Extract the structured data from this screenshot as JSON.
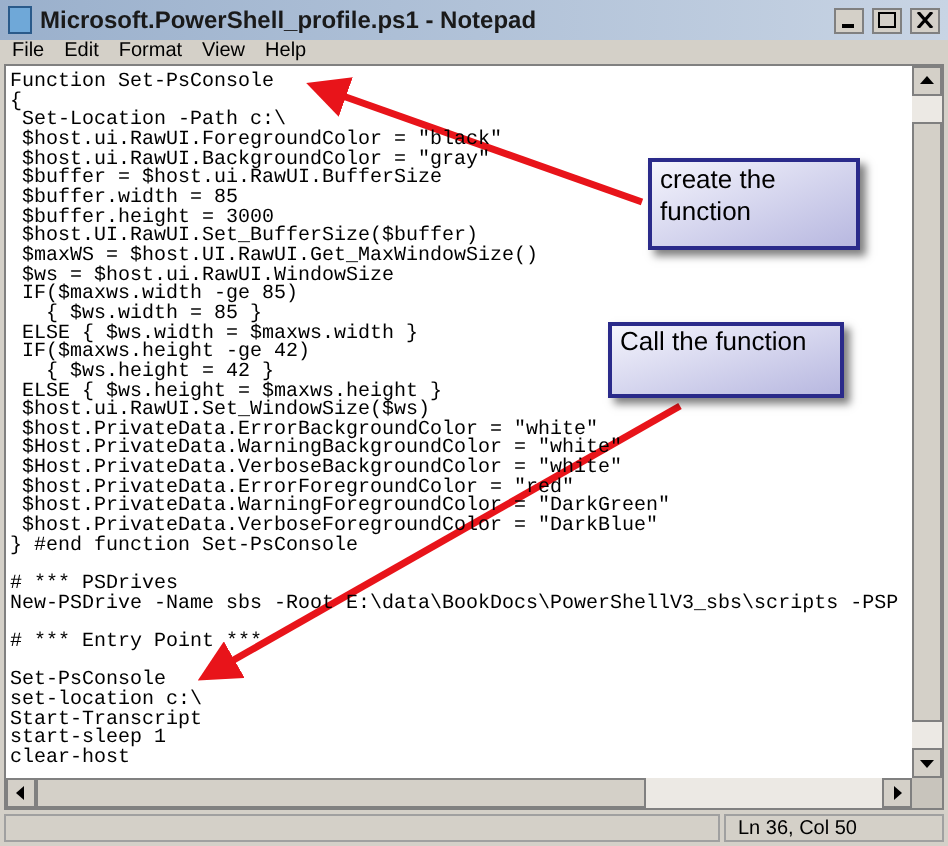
{
  "window": {
    "title": "Microsoft.PowerShell_profile.ps1 - Notepad"
  },
  "menu": [
    "File",
    "Edit",
    "Format",
    "View",
    "Help"
  ],
  "blocks": [
    [
      "Function Set-PsConsole",
      "{",
      " Set-Location -Path c:\\",
      " $host.ui.RawUI.ForegroundColor = \"black\"",
      " $host.ui.RawUI.BackgroundColor = \"gray\"",
      " $buffer = $host.ui.RawUI.BufferSize",
      " $buffer.width = 85",
      " $buffer.height = 3000",
      " $host.UI.RawUI.Set_BufferSize($buffer)",
      " $maxWS = $host.UI.RawUI.Get_MaxWindowSize()",
      " $ws = $host.ui.RawUI.WindowSize",
      " IF($maxws.width -ge 85)",
      "   { $ws.width = 85 }",
      " ELSE { $ws.width = $maxws.width }",
      " IF($maxws.height -ge 42)",
      "   { $ws.height = 42 }",
      " ELSE { $ws.height = $maxws.height }",
      " $host.ui.RawUI.Set_WindowSize($ws)",
      " $host.PrivateData.ErrorBackgroundColor = \"white\"",
      " $Host.PrivateData.WarningBackgroundColor = \"white\"",
      " $Host.PrivateData.VerboseBackgroundColor = \"white\"",
      " $host.PrivateData.ErrorForegroundColor = \"red\"",
      " $host.PrivateData.WarningForegroundColor = \"DarkGreen\"",
      " $host.PrivateData.VerboseForegroundColor = \"DarkBlue\"",
      "} #end function Set-PsConsole"
    ],
    [
      "# *** PSDrives",
      "New-PSDrive -Name sbs -Root E:\\data\\BookDocs\\PowerShellV3_sbs\\scripts -PSP"
    ],
    [
      "# *** Entry Point ***"
    ],
    [
      "Set-PsConsole",
      "set-location c:\\",
      "Start-Transcript",
      "start-sleep 1",
      "clear-host"
    ]
  ],
  "callouts": [
    "create the function",
    "Call the function"
  ],
  "status_bar": {
    "position": "Ln 36, Col 50"
  }
}
